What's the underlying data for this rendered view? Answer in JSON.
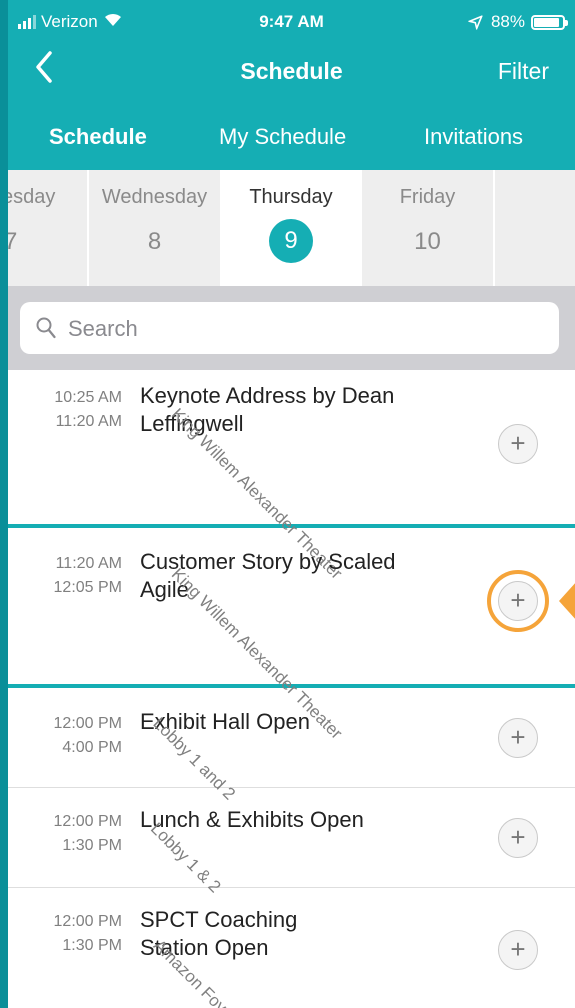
{
  "status": {
    "carrier": "Verizon",
    "time": "9:47 AM",
    "battery": "88%",
    "battery_level": 0.88
  },
  "nav": {
    "title": "Schedule",
    "filter_label": "Filter"
  },
  "tabs": [
    {
      "label": "Schedule",
      "active": true
    },
    {
      "label": "My Schedule",
      "active": false
    },
    {
      "label": "Invitations",
      "active": false
    }
  ],
  "days": [
    {
      "name": "esday",
      "num": "7"
    },
    {
      "name": "Wednesday",
      "num": "8"
    },
    {
      "name": "Thursday",
      "num": "9",
      "active": true
    },
    {
      "name": "Friday",
      "num": "10"
    },
    {
      "name": "",
      "num": ""
    }
  ],
  "search": {
    "placeholder": "Search"
  },
  "sessions": [
    {
      "start": "10:25 AM",
      "end": "11:20 AM",
      "title": "Keynote Address by Dean Leffingwell",
      "location": "King Willem Alexander Theater"
    },
    {
      "start": "11:20 AM",
      "end": "12:05 PM",
      "title": "Customer Story by Scaled Agile",
      "location": "King Willem Alexander Theater"
    },
    {
      "start": "12:00 PM",
      "end": "4:00 PM",
      "title": "Exhibit Hall Open",
      "location": "Lobby 1 and 2"
    },
    {
      "start": "12:00 PM",
      "end": "1:30 PM",
      "title": "Lunch & Exhibits Open",
      "location": "Lobby 1 & 2"
    },
    {
      "start": "12:00 PM",
      "end": "1:30 PM",
      "title": "SPCT Coaching Station Open",
      "location": "Amazon Foyer"
    }
  ],
  "add_symbol": "+",
  "colors": {
    "header": "#15aeb4",
    "accent_highlight": "#f5a43a",
    "frame": "#0a8f99"
  }
}
